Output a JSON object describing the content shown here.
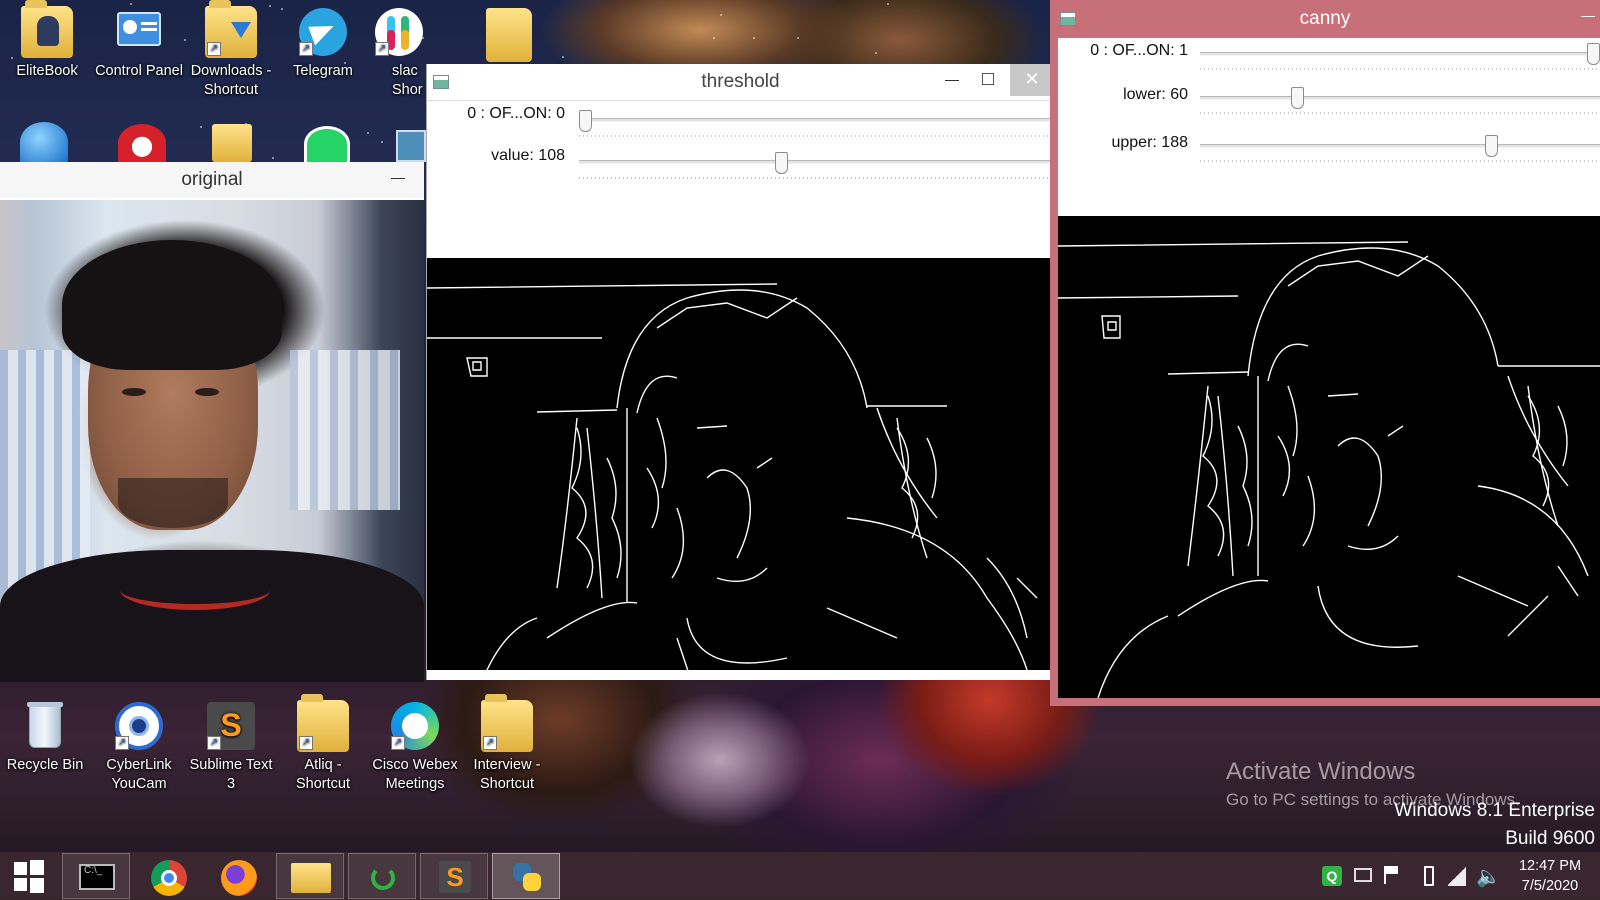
{
  "desktop": {
    "top_icons": [
      {
        "label": "EliteBook",
        "icon": "elitebook-folder-icon"
      },
      {
        "label": "Control Panel",
        "icon": "control-panel-icon"
      },
      {
        "label": "Downloads - Shortcut",
        "icon": "downloads-folder-icon"
      },
      {
        "label": "Telegram",
        "icon": "telegram-icon"
      },
      {
        "label": "slac Shor",
        "icon": "slack-icon"
      }
    ],
    "bottom_icons": [
      {
        "label": "Recycle Bin",
        "icon": "recycle-bin-icon"
      },
      {
        "label": "CyberLink YouCam",
        "icon": "youcam-icon"
      },
      {
        "label": "Sublime Text 3",
        "icon": "sublime-text-icon"
      },
      {
        "label": "Atliq - Shortcut",
        "icon": "atliq-folder-icon"
      },
      {
        "label": "Cisco Webex Meetings",
        "icon": "webex-icon"
      },
      {
        "label": "Interview - Shortcut",
        "icon": "interview-folder-icon"
      }
    ],
    "activate": {
      "title": "Activate Windows",
      "subtitle": "Go to PC settings to activate Windows."
    },
    "edition": {
      "line1": "Windows 8.1 Enterprise",
      "line2": "Build 9600"
    }
  },
  "windows": {
    "original": {
      "title": "original",
      "minimize": "—"
    },
    "threshold": {
      "title": "threshold",
      "minimize": "—",
      "maximize": "□",
      "close": "✕",
      "trackbars": [
        {
          "label": "0 : OF...ON: 0",
          "value": 0,
          "max": 1
        },
        {
          "label": "value: 108",
          "value": 108,
          "max": 255
        }
      ]
    },
    "canny": {
      "title": "canny",
      "minimize": "—",
      "trackbars": [
        {
          "label": "0 : OF...ON: 1",
          "value": 1,
          "max": 1
        },
        {
          "label": "lower: 60",
          "value": 60,
          "max": 255
        },
        {
          "label": "upper: 188",
          "value": 188,
          "max": 255
        }
      ]
    }
  },
  "taskbar": {
    "start_icon": "windows-start-icon",
    "apps": [
      {
        "icon": "command-prompt-icon"
      },
      {
        "icon": "chrome-icon"
      },
      {
        "icon": "firefox-icon"
      },
      {
        "icon": "file-explorer-icon"
      },
      {
        "icon": "refresh-app-icon"
      },
      {
        "icon": "sublime-text-icon"
      },
      {
        "icon": "python-icon"
      }
    ],
    "clock": {
      "time": "12:47 PM",
      "date": "7/5/2020"
    }
  }
}
